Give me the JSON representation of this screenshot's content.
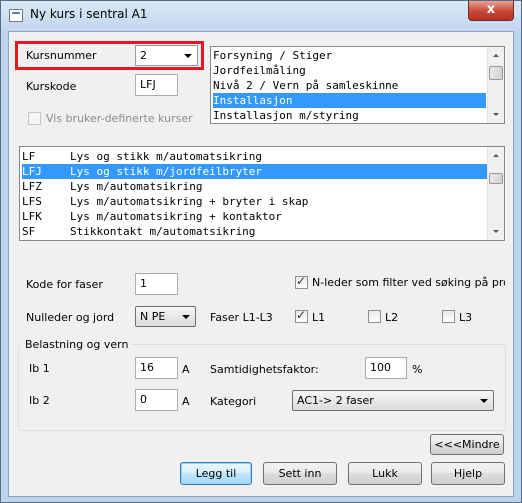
{
  "window": {
    "title": "Ny kurs i sentral  A1",
    "close_symbol": "x"
  },
  "kursnummer": {
    "label": "Kursnummer",
    "value": "2"
  },
  "kurskode": {
    "label": "Kurskode",
    "value": "LFJ"
  },
  "vis_bruker": {
    "label": "Vis bruker-definerte kurser",
    "checked": false
  },
  "category_list": {
    "items": [
      "Forsyning / Stiger",
      "Jordfeilmåling",
      "Nivå 2 / Vern på samleskinne",
      "Installasjon",
      "Installasjon m/styring"
    ],
    "selected_index": 3
  },
  "course_list": {
    "items": [
      {
        "code": "LF",
        "desc": "Lys og stikk m/automatsikring"
      },
      {
        "code": "LFJ",
        "desc": "Lys og stikk m/jordfeilbryter"
      },
      {
        "code": "LFZ",
        "desc": "Lys m/automatsikring"
      },
      {
        "code": "LFS",
        "desc": "Lys m/automatsikring + bryter i skap"
      },
      {
        "code": "LFK",
        "desc": "Lys m/automatsikring + kontaktor"
      },
      {
        "code": "SF",
        "desc": "Stikkontakt m/automatsikring"
      }
    ],
    "selected_index": 1
  },
  "kode_faser": {
    "label": "Kode for faser",
    "value": "1"
  },
  "n_leder": {
    "label": "N-leder som filter ved søking på produkter",
    "checked": true
  },
  "nulleder": {
    "label": "Nulleder og jord",
    "value": "N PE"
  },
  "faser": {
    "label": "Faser L1-L3",
    "l1": {
      "label": "L1",
      "checked": true
    },
    "l2": {
      "label": "L2",
      "checked": false
    },
    "l3": {
      "label": "L3",
      "checked": false
    }
  },
  "belastning": {
    "group_label": "Belastning og vern",
    "ib1": {
      "label": "Ib 1",
      "value": "16",
      "unit": "A"
    },
    "ib2": {
      "label": "Ib 2",
      "value": "0",
      "unit": "A"
    },
    "samtidighet": {
      "label": "Samtidighetsfaktor:",
      "value": "100",
      "unit": "%"
    },
    "kategori": {
      "label": "Kategori",
      "value": "AC1-> 2 faser"
    }
  },
  "buttons": {
    "mindre": "<<<Mindre",
    "legg_til": "Legg til",
    "sett_inn": "Sett inn",
    "lukk": "Lukk",
    "hjelp": "Hjelp"
  },
  "colors": {
    "selection": "#3399ff",
    "highlight_frame": "#e8161e",
    "title_bar": "#c3d7ee"
  }
}
